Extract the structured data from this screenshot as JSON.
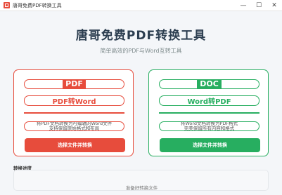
{
  "window": {
    "title": "唐哥免费PDF转换工具",
    "controls": {
      "minimize": "—",
      "maximize": "☐",
      "close": "✕"
    }
  },
  "header": {
    "title": "唐哥免费PDF转换工具",
    "subtitle": "简单高效的PDF与Word互转工具"
  },
  "cards": {
    "pdf_to_word": {
      "badge": "PDF",
      "name": "PDF转Word",
      "description_line1": "将PDF文档转换为可编辑的Word文件",
      "description_line2": "支持保留原始格式和布局",
      "button_label": "选择文件并转换",
      "color": "#e74c3c"
    },
    "word_to_pdf": {
      "badge": "DOC",
      "name": "Word转PDF",
      "description_line1": "将Word文档转换为PDF格式",
      "description_line2": "完美保留所有内容和格式",
      "button_label": "选择文件并转换",
      "color": "#27ae60"
    }
  },
  "progress": {
    "label": "转换进度",
    "status": "准备好转换文件"
  }
}
